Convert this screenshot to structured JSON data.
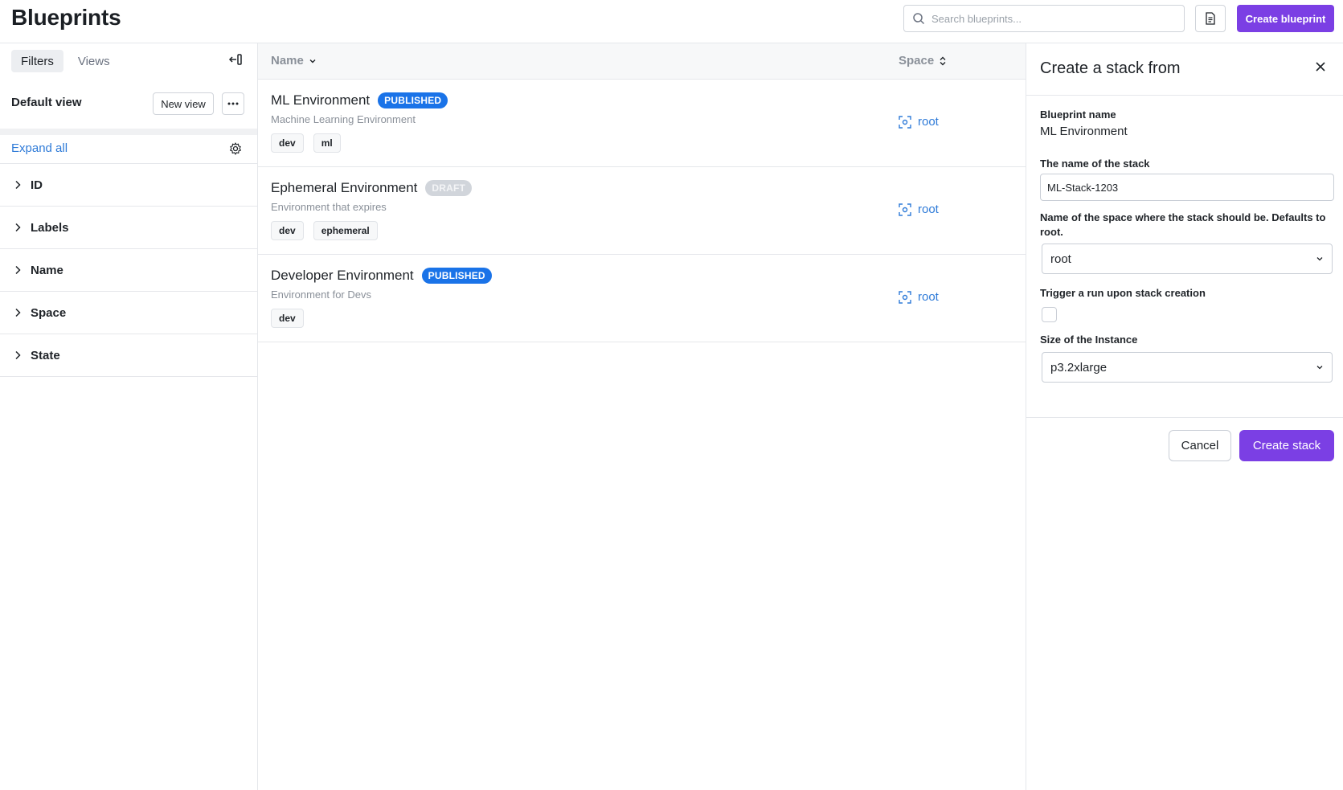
{
  "header": {
    "title": "Blueprints",
    "search_placeholder": "Search blueprints...",
    "create_label": "Create blueprint"
  },
  "sidebar": {
    "tabs": [
      "Filters",
      "Views"
    ],
    "view_name": "Default view",
    "new_view_label": "New view",
    "expand_all_label": "Expand all",
    "filters": [
      "ID",
      "Labels",
      "Name",
      "Space",
      "State"
    ]
  },
  "table": {
    "columns": {
      "name": "Name",
      "space": "Space"
    },
    "rows": [
      {
        "name": "ML Environment",
        "status": "PUBLISHED",
        "description": "Machine Learning Environment",
        "labels": [
          "dev",
          "ml"
        ],
        "space": "root"
      },
      {
        "name": "Ephemeral Environment",
        "status": "DRAFT",
        "description": "Environment that expires",
        "labels": [
          "dev",
          "ephemeral"
        ],
        "space": "root"
      },
      {
        "name": "Developer Environment",
        "status": "PUBLISHED",
        "description": "Environment for Devs",
        "labels": [
          "dev"
        ],
        "space": "root"
      }
    ]
  },
  "drawer": {
    "title": "Create a stack from",
    "blueprint_name_label": "Blueprint name",
    "blueprint_name_value": "ML Environment",
    "stack_name_label": "The name of the stack",
    "stack_name_value": "ML-Stack-1203",
    "space_label": "Name of the space where the stack should be. Defaults to root.",
    "space_value": "root",
    "trigger_label": "Trigger a run upon stack creation",
    "trigger_checked": false,
    "instance_label": "Size of the Instance",
    "instance_value": "p3.2xlarge",
    "cancel_label": "Cancel",
    "create_label": "Create stack"
  },
  "colors": {
    "accent": "#7b3fe4",
    "link": "#2f7bd8",
    "published_badge": "#1a73e8",
    "draft_badge": "#d1d5db"
  }
}
